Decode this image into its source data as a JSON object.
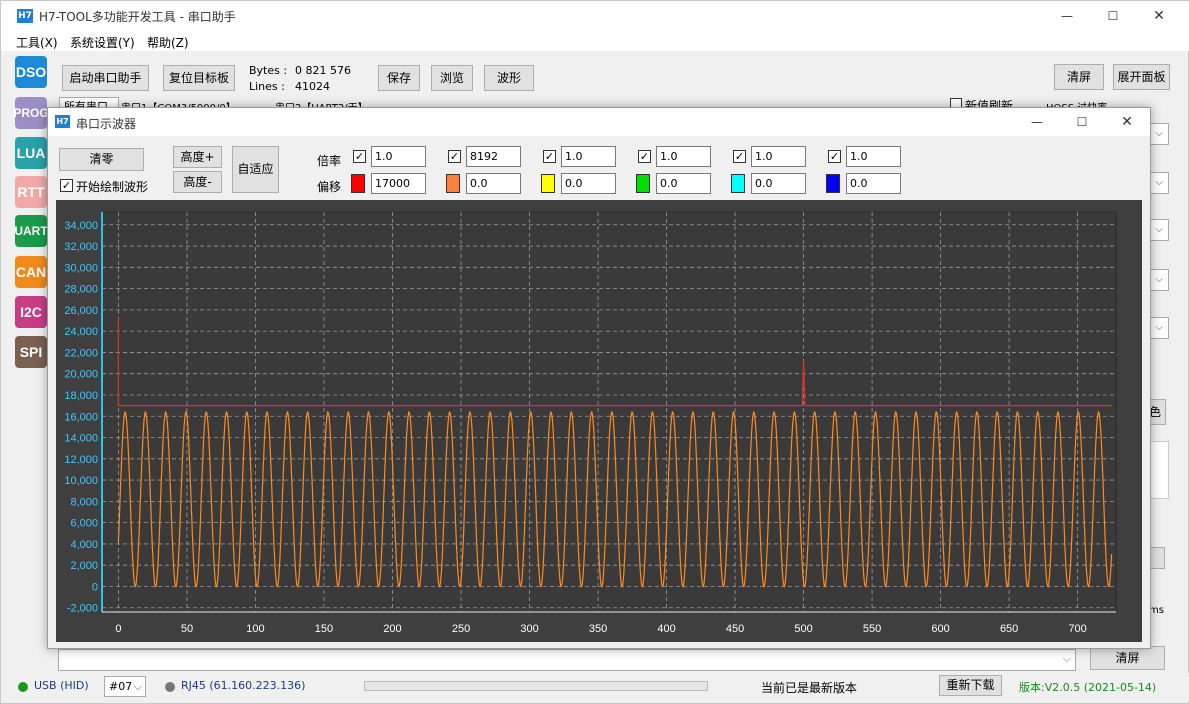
{
  "window": {
    "title": "H7-TOOL多功能开发工具 - 串口助手",
    "logo": "H7",
    "minimize_icon": "—",
    "maximize_icon": "☐",
    "close_icon": "✕"
  },
  "menu": [
    "工具(X)",
    "系统设置(Y)",
    "帮助(Z)"
  ],
  "sidebar": [
    {
      "label": "DSO",
      "color": "#1e8ad6"
    },
    {
      "label": "PROG",
      "color": "#9a8fc4"
    },
    {
      "label": "LUA",
      "color": "#2aa0a8"
    },
    {
      "label": "RTT",
      "color": "#f0a8a8"
    },
    {
      "label": "UART",
      "color": "#1a9a4a"
    },
    {
      "label": "CAN",
      "color": "#f08a1c"
    },
    {
      "label": "I2C",
      "color": "#c83c86"
    },
    {
      "label": "SPI",
      "color": "#7a6050"
    }
  ],
  "toolbar": {
    "start_serial": "启动串口助手",
    "reset_board": "复位目标板",
    "bytes_label": "Bytes :",
    "bytes_value": "0 821 576",
    "lines_label": "Lines :",
    "lines_value": "41024",
    "save": "保存",
    "browse": "浏览",
    "waveform": "波形",
    "clear_screen": "清屏",
    "expand_panel": "展开面板"
  },
  "tabs": {
    "tab1": "所有串口",
    "tab2": "串口1【COM3/5000/0】",
    "tab3": "串口2【UART2/无】"
  },
  "right_panel": {
    "new_refresh": "新值刷新",
    "filter": "HOSS 过快率",
    "color_btn": "色",
    "ms": "ms"
  },
  "scope": {
    "title": "串口示波器",
    "logo": "H7",
    "clear": "清零",
    "height_plus": "高度+",
    "height_minus": "高度-",
    "auto_fit": "自适应",
    "start_draw": "开始绘制波形",
    "scale_label": "倍率",
    "offset_label": "偏移",
    "channels": [
      {
        "scale": "1.0",
        "offset": "17000",
        "color": "#ff0000",
        "enabled": true
      },
      {
        "scale": "8192",
        "offset": "0.0",
        "color": "#ff8040",
        "enabled": true
      },
      {
        "scale": "1.0",
        "offset": "0.0",
        "color": "#ffff00",
        "enabled": true
      },
      {
        "scale": "1.0",
        "offset": "0.0",
        "color": "#00e000",
        "enabled": true
      },
      {
        "scale": "1.0",
        "offset": "0.0",
        "color": "#00ffff",
        "enabled": true
      },
      {
        "scale": "1.0",
        "offset": "0.0",
        "color": "#0000ff",
        "enabled": true
      }
    ]
  },
  "chart_data": {
    "type": "line",
    "xlim": [
      -12,
      728
    ],
    "ylim": [
      -2400,
      35200
    ],
    "x_ticks": [
      0,
      50,
      100,
      150,
      200,
      250,
      300,
      350,
      400,
      450,
      500,
      550,
      600,
      650,
      700
    ],
    "y_ticks": [
      -2000,
      0,
      2000,
      4000,
      6000,
      8000,
      10000,
      12000,
      14000,
      16000,
      18000,
      20000,
      22000,
      24000,
      26000,
      28000,
      30000,
      32000,
      34000
    ],
    "y_tick_labels": [
      "-2,000",
      "0",
      "2,000",
      "4,000",
      "6,000",
      "8,000",
      "10,000",
      "12,000",
      "14,000",
      "16,000",
      "18,000",
      "20,000",
      "22,000",
      "24,000",
      "26,000",
      "28,000",
      "30,000",
      "32,000",
      "34,000"
    ],
    "grid": true,
    "series": [
      {
        "color": "#e03030",
        "x": [
          0,
          0,
          1,
          499,
          500,
          501,
          725
        ],
        "y": [
          25200,
          17000,
          17000,
          17000,
          21200,
          17000,
          17000
        ]
      },
      {
        "color": "#ff8a1e",
        "kind": "sine",
        "x_start": 0,
        "x_end": 725,
        "period": 14.8,
        "center": 8200,
        "amplitude": 8200
      }
    ]
  },
  "bottom": {
    "clear": "清屏"
  },
  "status": {
    "usb": "USB (HID)",
    "device": "#07",
    "network": "RJ45 (61.160.223.136)",
    "update_msg": "当前已是最新版本",
    "redownload": "重新下载",
    "version": "版本:V2.0.5 (2021-05-14)",
    "dropdown_icon": "⌵"
  }
}
